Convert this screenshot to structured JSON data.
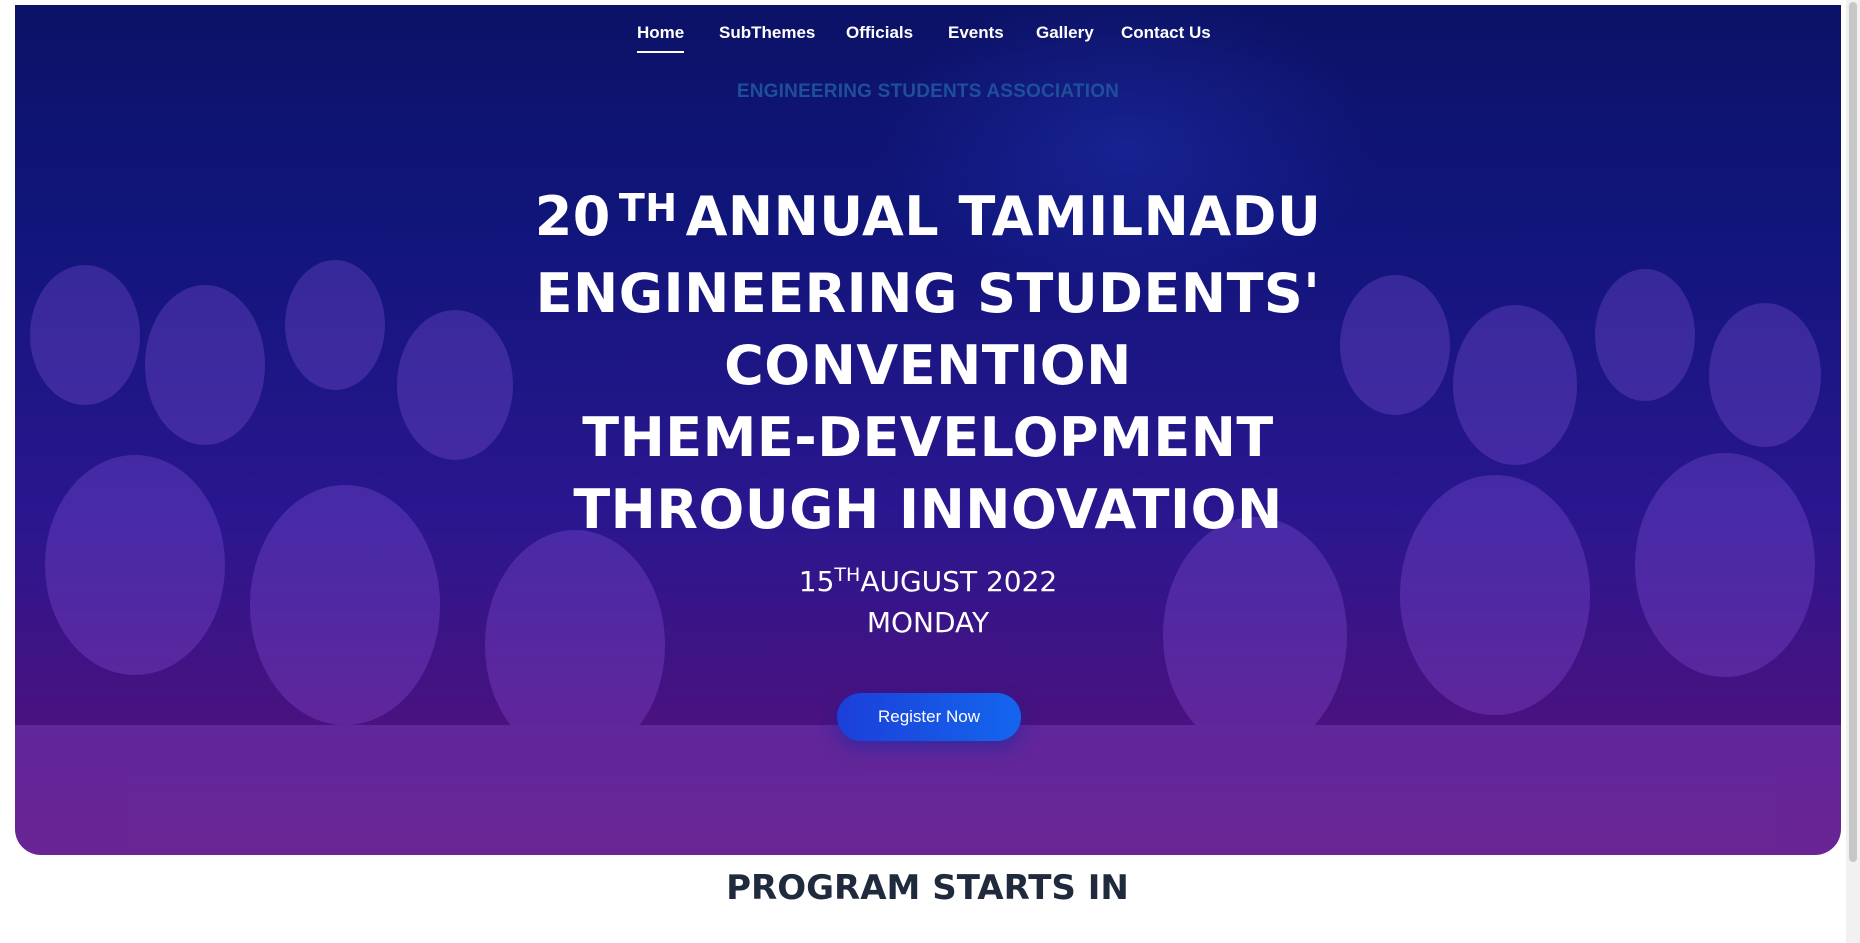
{
  "nav": {
    "items": [
      {
        "label": "Home",
        "active": true
      },
      {
        "label": "SubThemes",
        "active": false
      },
      {
        "label": "Officials",
        "active": false
      },
      {
        "label": "Events",
        "active": false
      },
      {
        "label": "Gallery",
        "active": false
      },
      {
        "label": "Contact Us",
        "active": false
      }
    ]
  },
  "hero": {
    "organization": "ENGINEERING STUDENTS ASSOCIATION",
    "headline": {
      "line1_number": "20",
      "line1_suffix": "TH",
      "line1_rest": "ANNUAL TAMILNADU",
      "line2": "ENGINEERING STUDENTS'",
      "line3": "CONVENTION",
      "line4": "THEME-DEVELOPMENT",
      "line5": "THROUGH INNOVATION"
    },
    "date": {
      "day": "15",
      "day_suffix": "TH",
      "month_year": "AUGUST 2022",
      "weekday": "MONDAY"
    },
    "register_label": "Register Now"
  },
  "program": {
    "heading": "PROGRAM STARTS IN"
  },
  "colors": {
    "hero_top": "#0c1266",
    "hero_bottom": "#561075",
    "button": "#1c3fd9",
    "organization_text": "#1e4f9a",
    "heading_text": "#1f2a3d"
  }
}
